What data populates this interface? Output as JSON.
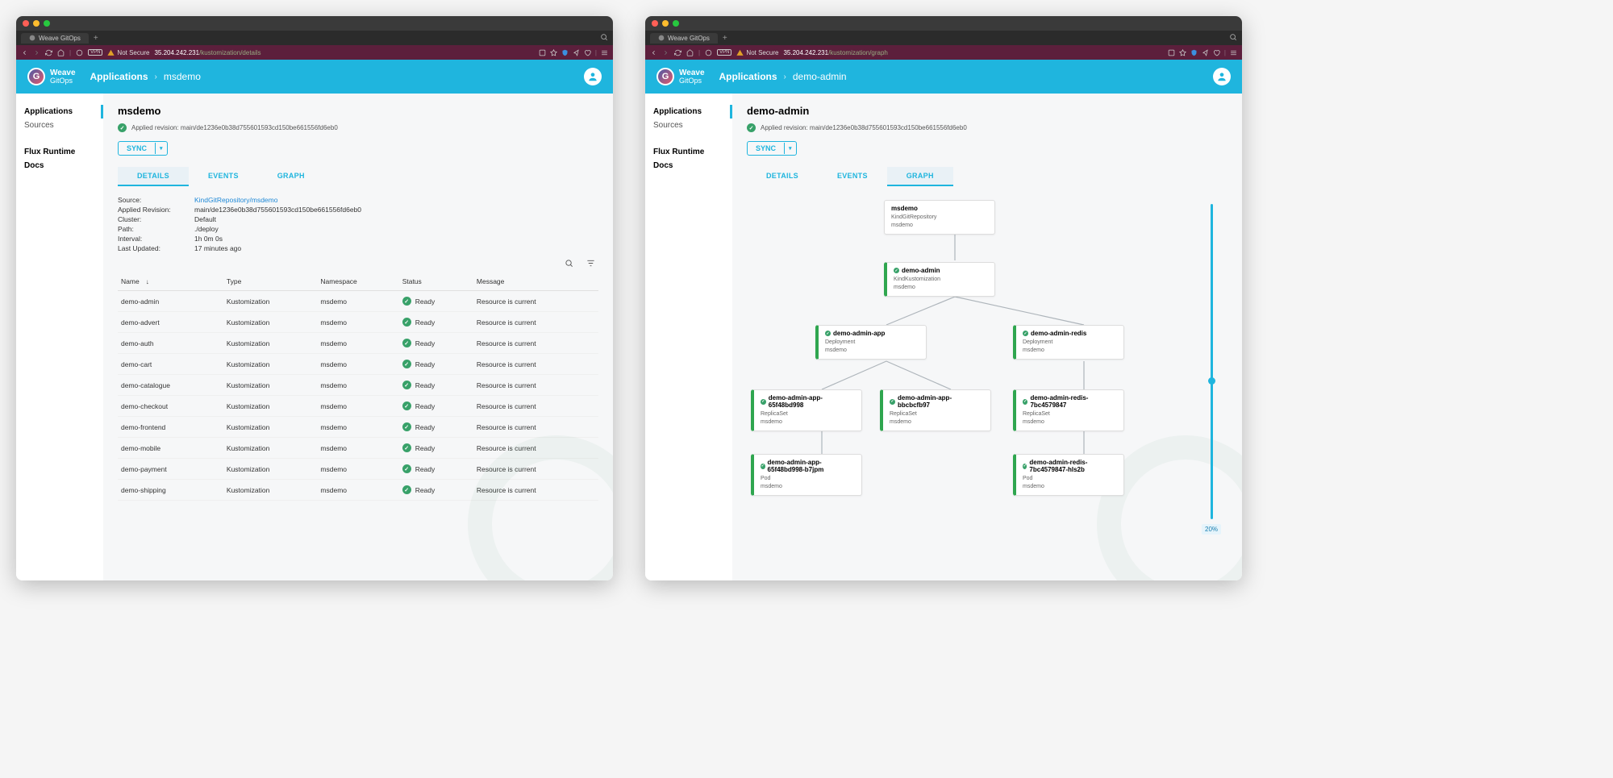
{
  "browser": {
    "tabTitle": "Weave GitOps",
    "notSecure": "Not Secure",
    "vpn": "VPN",
    "host": "35.204.242.231"
  },
  "left": {
    "urlPath": "/kustomization/details",
    "crumbRoot": "Applications",
    "crumbLeaf": "msdemo",
    "nav": {
      "applications": "Applications",
      "sources": "Sources",
      "flux": "Flux Runtime",
      "docs": "Docs"
    },
    "title": "msdemo",
    "appliedRevisionLine": "Applied revision: main/de1236e0b38d755601593cd150be661556fd6eb0",
    "sync": "SYNC",
    "tabs": {
      "details": "DETAILS",
      "events": "EVENTS",
      "graph": "GRAPH"
    },
    "kv": {
      "sourceK": "Source:",
      "sourceV": "KindGitRepository/msdemo",
      "revK": "Applied Revision:",
      "revV": "main/de1236e0b38d755601593cd150be661556fd6eb0",
      "clusterK": "Cluster:",
      "clusterV": "Default",
      "pathK": "Path:",
      "pathV": "./deploy",
      "intervalK": "Interval:",
      "intervalV": "1h 0m 0s",
      "updatedK": "Last Updated:",
      "updatedV": "17 minutes ago"
    },
    "cols": {
      "name": "Name",
      "type": "Type",
      "ns": "Namespace",
      "status": "Status",
      "msg": "Message"
    },
    "rows": [
      {
        "n": "demo-admin",
        "t": "Kustomization",
        "ns": "msdemo",
        "s": "Ready",
        "m": "Resource is current"
      },
      {
        "n": "demo-advert",
        "t": "Kustomization",
        "ns": "msdemo",
        "s": "Ready",
        "m": "Resource is current"
      },
      {
        "n": "demo-auth",
        "t": "Kustomization",
        "ns": "msdemo",
        "s": "Ready",
        "m": "Resource is current"
      },
      {
        "n": "demo-cart",
        "t": "Kustomization",
        "ns": "msdemo",
        "s": "Ready",
        "m": "Resource is current"
      },
      {
        "n": "demo-catalogue",
        "t": "Kustomization",
        "ns": "msdemo",
        "s": "Ready",
        "m": "Resource is current"
      },
      {
        "n": "demo-checkout",
        "t": "Kustomization",
        "ns": "msdemo",
        "s": "Ready",
        "m": "Resource is current"
      },
      {
        "n": "demo-frontend",
        "t": "Kustomization",
        "ns": "msdemo",
        "s": "Ready",
        "m": "Resource is current"
      },
      {
        "n": "demo-mobile",
        "t": "Kustomization",
        "ns": "msdemo",
        "s": "Ready",
        "m": "Resource is current"
      },
      {
        "n": "demo-payment",
        "t": "Kustomization",
        "ns": "msdemo",
        "s": "Ready",
        "m": "Resource is current"
      },
      {
        "n": "demo-shipping",
        "t": "Kustomization",
        "ns": "msdemo",
        "s": "Ready",
        "m": "Resource is current"
      }
    ]
  },
  "right": {
    "urlPath": "/kustomization/graph",
    "crumbRoot": "Applications",
    "crumbLeaf": "demo-admin",
    "title": "demo-admin",
    "appliedRevisionLine": "Applied revision: main/de1236e0b38d755601593cd150be661556fd6eb0",
    "sync": "SYNC",
    "tabs": {
      "details": "DETAILS",
      "events": "EVENTS",
      "graph": "GRAPH"
    },
    "zoom": "20%",
    "nodes": {
      "root": {
        "name": "msdemo",
        "k": "KindGitRepository",
        "ns": "msdemo"
      },
      "admin": {
        "name": "demo-admin",
        "k": "KindKustomization",
        "ns": "msdemo"
      },
      "depApp": {
        "name": "demo-admin-app",
        "k": "Deployment",
        "ns": "msdemo"
      },
      "depRedis": {
        "name": "demo-admin-redis",
        "k": "Deployment",
        "ns": "msdemo"
      },
      "rs1": {
        "name": "demo-admin-app-65f48bd998",
        "k": "ReplicaSet",
        "ns": "msdemo"
      },
      "rs2": {
        "name": "demo-admin-app-bbcbcfb97",
        "k": "ReplicaSet",
        "ns": "msdemo"
      },
      "rs3": {
        "name": "demo-admin-redis-7bc4579847",
        "k": "ReplicaSet",
        "ns": "msdemo"
      },
      "pod1": {
        "name": "demo-admin-app-65f48bd998-b7jpm",
        "k": "Pod",
        "ns": "msdemo"
      },
      "pod2": {
        "name": "demo-admin-redis-7bc4579847-hls2b",
        "k": "Pod",
        "ns": "msdemo"
      }
    }
  },
  "brand": {
    "top": "Weave",
    "bot": "GitOps"
  }
}
